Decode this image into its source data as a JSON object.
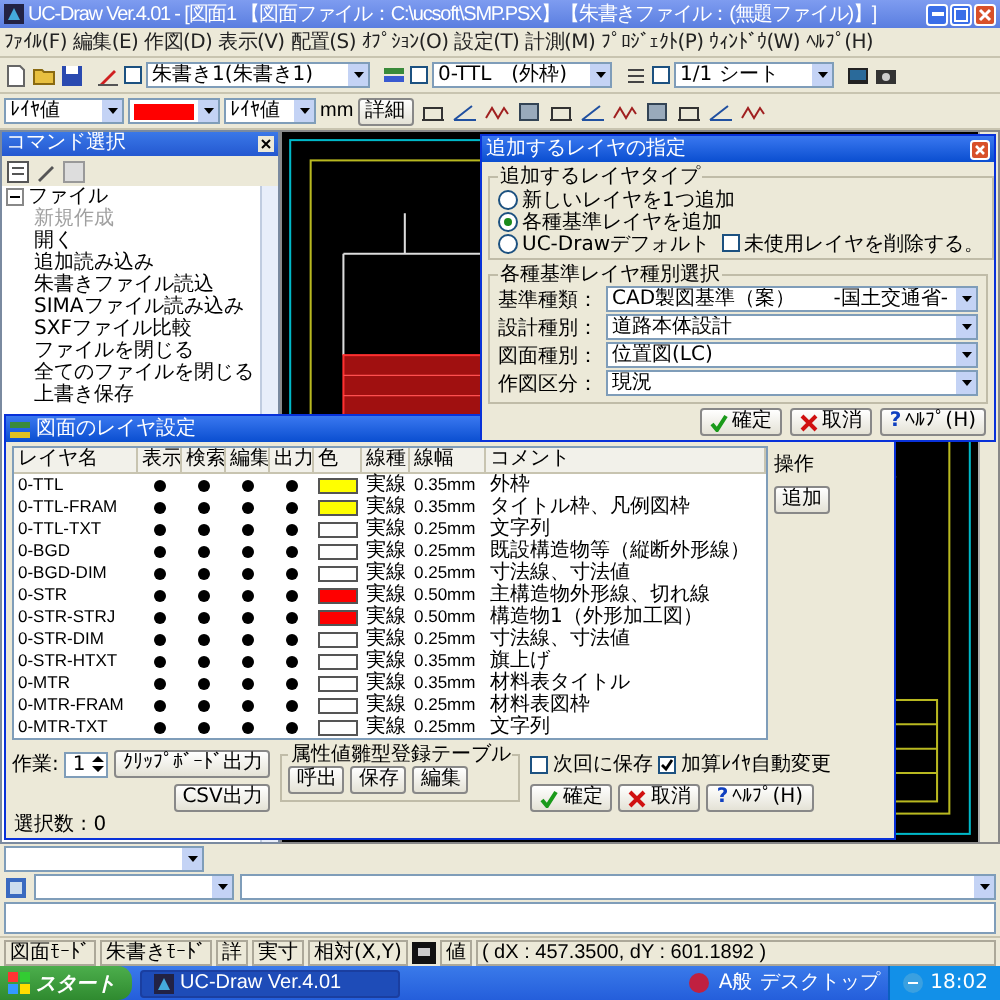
{
  "window": {
    "title": "UC-Draw Ver.4.01 - [図面1 【図面ファイル：C:\\ucsoft\\SMP.PSX】【朱書きファイル：(無題ファイル)】]"
  },
  "menu": [
    "ﾌｧｲﾙ(F)",
    "編集(E)",
    "作図(D)",
    "表示(V)",
    "配置(S)",
    "ｵﾌﾟｼｮﾝ(O)",
    "設定(T)",
    "計測(M)",
    "ﾌﾟﾛｼﾞｪｸﾄ(P)",
    "ｳｨﾝﾄﾞｳ(W)",
    "ﾍﾙﾌﾟ(H)"
  ],
  "toolbar1": {
    "combos": [
      {
        "value": "朱書き1(朱書き1)",
        "checked": false
      },
      {
        "value": "0-TTL　(外枠)",
        "checked": false
      },
      {
        "value": "1/1 シート",
        "checked": false
      }
    ]
  },
  "toolbar2": {
    "layer_value": "ﾚｲﾔ値",
    "color": "#ff0000",
    "width_value": "ﾚｲﾔ値",
    "unit": "mm",
    "detail_button": "詳細"
  },
  "command_panel": {
    "title": "コマンド選択",
    "tree": [
      {
        "label": "ファイル",
        "expanded": true,
        "children": [
          {
            "label": "新規作成",
            "disabled": true
          },
          {
            "label": "開く",
            "disabled": false
          },
          {
            "label": "追加読み込み",
            "disabled": false
          },
          {
            "label": "朱書きファイル読込",
            "disabled": false
          },
          {
            "label": "SIMAファイル読み込み",
            "disabled": false
          },
          {
            "label": "SXFファイル比較",
            "disabled": false
          },
          {
            "label": "ファイルを閉じる",
            "disabled": false
          },
          {
            "label": "全てのファイルを閉じる",
            "disabled": false
          },
          {
            "label": "上書き保存",
            "disabled": false
          }
        ]
      }
    ]
  },
  "layer_dialog": {
    "title": "図面のレイヤ設定",
    "columns": [
      "レイヤ名",
      "表示",
      "検索",
      "編集",
      "出力",
      "色",
      "線種",
      "線幅",
      "コメント"
    ],
    "rows": [
      {
        "name": "0-TTL",
        "visible": true,
        "search": true,
        "edit": true,
        "output": true,
        "color": "#ffff00",
        "linetype": "実線",
        "width": "0.35mm",
        "comment": "外枠"
      },
      {
        "name": "0-TTL-FRAM",
        "visible": true,
        "search": true,
        "edit": true,
        "output": true,
        "color": "#ffff00",
        "linetype": "実線",
        "width": "0.35mm",
        "comment": "タイトル枠、凡例図枠"
      },
      {
        "name": "0-TTL-TXT",
        "visible": true,
        "search": true,
        "edit": true,
        "output": true,
        "color": "#ffffff",
        "linetype": "実線",
        "width": "0.25mm",
        "comment": "文字列"
      },
      {
        "name": "0-BGD",
        "visible": true,
        "search": true,
        "edit": true,
        "output": true,
        "color": "#ffffff",
        "linetype": "実線",
        "width": "0.25mm",
        "comment": "既設構造物等（縦断外形線）"
      },
      {
        "name": "0-BGD-DIM",
        "visible": true,
        "search": true,
        "edit": true,
        "output": true,
        "color": "#ffffff",
        "linetype": "実線",
        "width": "0.25mm",
        "comment": "寸法線、寸法値"
      },
      {
        "name": "0-STR",
        "visible": true,
        "search": true,
        "edit": true,
        "output": true,
        "color": "#ff0000",
        "linetype": "実線",
        "width": "0.50mm",
        "comment": "主構造物外形線、切れ線"
      },
      {
        "name": "0-STR-STRJ",
        "visible": true,
        "search": true,
        "edit": true,
        "output": true,
        "color": "#ff0000",
        "linetype": "実線",
        "width": "0.50mm",
        "comment": "構造物1（外形加工図）"
      },
      {
        "name": "0-STR-DIM",
        "visible": true,
        "search": true,
        "edit": true,
        "output": true,
        "color": "#ffffff",
        "linetype": "実線",
        "width": "0.25mm",
        "comment": "寸法線、寸法値"
      },
      {
        "name": "0-STR-HTXT",
        "visible": true,
        "search": true,
        "edit": true,
        "output": true,
        "color": "#ffffff",
        "linetype": "実線",
        "width": "0.35mm",
        "comment": "旗上げ"
      },
      {
        "name": "0-MTR",
        "visible": true,
        "search": true,
        "edit": true,
        "output": true,
        "color": "#ffffff",
        "linetype": "実線",
        "width": "0.35mm",
        "comment": "材料表タイトル"
      },
      {
        "name": "0-MTR-FRAM",
        "visible": true,
        "search": true,
        "edit": true,
        "output": true,
        "color": "#ffffff",
        "linetype": "実線",
        "width": "0.25mm",
        "comment": "材料表図枠"
      },
      {
        "name": "0-MTR-TXT",
        "visible": true,
        "search": true,
        "edit": true,
        "output": true,
        "color": "#ffffff",
        "linetype": "実線",
        "width": "0.25mm",
        "comment": "文字列"
      }
    ],
    "ops_label": "操作",
    "ops_buttons": [
      "追加"
    ],
    "work_label": "作業:",
    "work_value": "1",
    "clipboard_button": "ｸﾘｯﾌﾟﾎﾞｰﾄﾞ出力",
    "csv_button": "CSV出力",
    "template_group": {
      "legend": "属性値雛型登録テーブル",
      "buttons": [
        "呼出",
        "保存",
        "編集"
      ]
    },
    "options": [
      {
        "label": "次回に保存",
        "checked": false
      },
      {
        "label": "加算ﾚｲﾔ自動変更",
        "checked": true
      }
    ],
    "buttons": [
      {
        "label": "確定",
        "kind": "ok"
      },
      {
        "label": "取消",
        "kind": "cancel"
      },
      {
        "label": "ﾍﾙﾌﾟ(H)",
        "kind": "help",
        "icon": "?"
      }
    ],
    "status": "選択数 : 0"
  },
  "add_layer_dialog": {
    "title": "追加するレイヤの指定",
    "type_group": {
      "legend": "追加するレイヤタイプ",
      "options": [
        {
          "label": "新しいレイヤを1つ追加",
          "selected": false
        },
        {
          "label": "各種基準レイヤを追加",
          "selected": true
        },
        {
          "label": "UC-Drawデフォルト",
          "selected": false
        }
      ],
      "delete_unused": {
        "label": "未使用レイヤを削除する。",
        "checked": false
      }
    },
    "standard_group": {
      "legend": "各種基準レイヤ種別選択",
      "fields": [
        {
          "label": "基準種類：",
          "value": "CAD製図基準（案）",
          "note": "-国土交通省-"
        },
        {
          "label": "設計種別：",
          "value": "道路本体設計"
        },
        {
          "label": "図面種別：",
          "value": "位置図(LC)"
        },
        {
          "label": "作図区分：",
          "value": "現況"
        }
      ]
    },
    "buttons": [
      {
        "label": "確定",
        "kind": "ok"
      },
      {
        "label": "取消",
        "kind": "cancel"
      },
      {
        "label": "ﾍﾙﾌﾟ(H)",
        "kind": "help",
        "icon": "?"
      }
    ]
  },
  "status_bar": {
    "items": [
      {
        "label": "図面ﾓｰﾄﾞ",
        "icon": false
      },
      {
        "label": "朱書きﾓｰﾄﾞ",
        "icon": false
      },
      {
        "label": "詳",
        "icon": false
      },
      {
        "label": "実寸",
        "icon": false
      },
      {
        "label": "相対(X,Y)",
        "icon": false
      },
      {
        "label": "値",
        "icon": true
      }
    ],
    "coordinates": "( dX : 457.3500, dY : 601.1892 )"
  },
  "taskbar": {
    "start": "スタート",
    "tasks": [
      {
        "label": "UC-Draw Ver.4.01",
        "selected": true
      }
    ],
    "ime": "A般",
    "toolbar": "デスクトップ",
    "clock": "18:02"
  }
}
